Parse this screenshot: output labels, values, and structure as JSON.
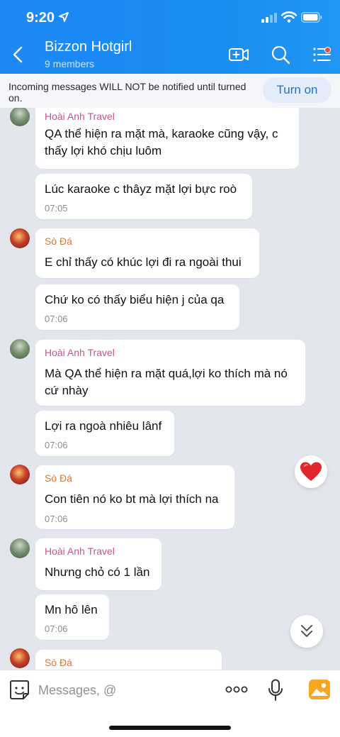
{
  "status_bar": {
    "time": "9:20"
  },
  "header": {
    "title": "Bizzon Hotgirl",
    "subtitle": "9 members",
    "icons": [
      "back-icon",
      "video-call-icon",
      "search-icon",
      "menu-icon"
    ]
  },
  "notice": {
    "text": "Incoming messages WILL NOT be notified until turned on.",
    "button_label": "Turn on"
  },
  "messages": [
    {
      "sender": "Hoài Anh Travel",
      "text": "QA thể hiện ra mặt mà, karaoke cũng vậy, c thấy lợi khó chịu luôm",
      "time": ""
    },
    {
      "sender": "",
      "text": "Lúc karaoke c thâyz mặt lợi bực roò",
      "time": "07:05"
    },
    {
      "sender": "Sò Đá",
      "text": "E chỉ thấy có khúc lợi đi ra ngoài thui",
      "time": ""
    },
    {
      "sender": "",
      "text": "Chứ ko có thấy biểu hiện j của qa",
      "time": "07:06"
    },
    {
      "sender": "Hoài Anh Travel",
      "text": "Mà QA thể hiện ra mặt quá,lợi ko thích mà nó cứ nhày",
      "time": ""
    },
    {
      "sender": "",
      "text": "Lợi ra ngoà nhiêu lânf",
      "time": "07:06"
    },
    {
      "sender": "Sò Đá",
      "text": "Con tiên nó ko bt mà lợi thích na",
      "time": "07:06"
    },
    {
      "sender": "Hoài Anh Travel",
      "text": "Nhưng chỏ có 1 lần",
      "time": ""
    },
    {
      "sender": "",
      "text": "Mn hô lên",
      "time": "07:06"
    },
    {
      "sender": "Sò Đá",
      "text": "",
      "time": ""
    }
  ],
  "input": {
    "placeholder": "Messages, @"
  },
  "colors": {
    "header_blue": "#1e88f5",
    "sender_hoai": "#c0568f",
    "sender_so": "#d4793a",
    "turn_on_text": "#1a74d8",
    "heart": "#e0262f",
    "image_icon": "#f5a623"
  }
}
